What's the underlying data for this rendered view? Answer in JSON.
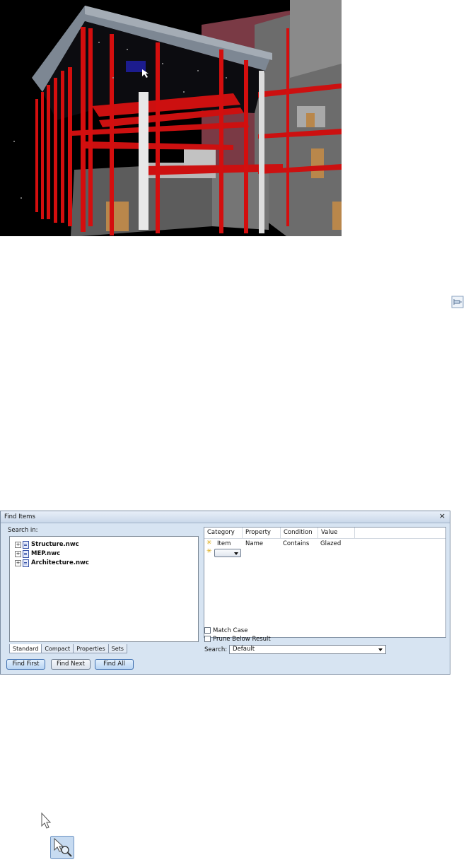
{
  "viewport": {
    "alt_icon": "3d-model-view"
  },
  "find_items": {
    "title": "Find Items",
    "close_glyph": "×",
    "search_in_label": "Search in:",
    "tree": [
      {
        "expander": "+",
        "name": "Structure.nwc",
        "icon": "model-file-icon"
      },
      {
        "expander": "+",
        "name": "MEP.nwc",
        "icon": "model-file-icon"
      },
      {
        "expander": "+",
        "name": "Architecture.nwc",
        "icon": "model-file-icon"
      }
    ],
    "tabs": [
      "Standard",
      "Compact",
      "Properties",
      "Sets"
    ],
    "active_tab": "Standard",
    "buttons": {
      "find_first": "Find First",
      "find_next": "Find Next",
      "find_all": "Find All"
    },
    "grid": {
      "headers": [
        "Category",
        "Property",
        "Condition",
        "Value"
      ],
      "rows": [
        {
          "category": "Item",
          "property": "Name",
          "condition": "Contains",
          "value": "Glazed"
        }
      ]
    },
    "match_case": {
      "label": "Match Case",
      "checked": false
    },
    "prune_below_result": {
      "label": "Prune Below Result",
      "checked": false
    },
    "search_label": "Search:",
    "search_value": "Default"
  },
  "icons": {
    "pin": "pin-icon",
    "cursor": "cursor-arrow-icon",
    "select": "select-box-icon"
  }
}
